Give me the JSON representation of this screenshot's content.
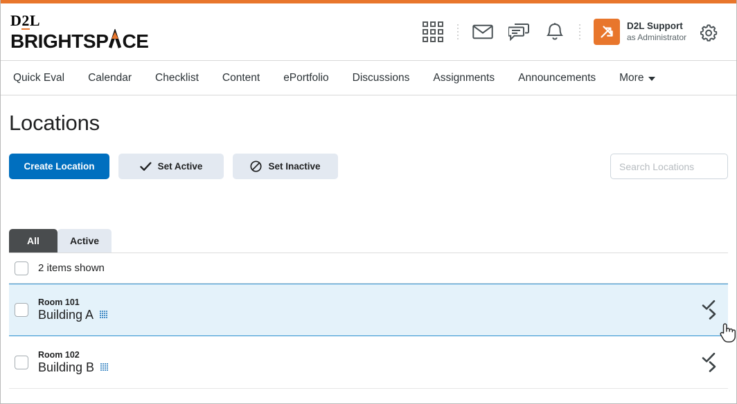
{
  "theme": {
    "accent_orange": "#e8762c",
    "primary_blue": "#006fbf",
    "selected_row_bg": "#e4f2fa",
    "selected_row_border": "#2a8fd0",
    "tab_active_bg": "#494c4e",
    "secondary_button_bg": "#e3e9f1"
  },
  "header": {
    "logo_d2l_prefix": "D",
    "logo_d2l_two": "2",
    "logo_d2l_suffix": "L",
    "logo_brightspace_part1": "BRIGHTSP",
    "logo_brightspace_part2": "CE",
    "icons": {
      "waffle": "waffle-grid-icon",
      "email": "envelope-icon",
      "messages": "chat-bubbles-icon",
      "notifications": "bell-icon",
      "settings": "gear-icon",
      "avatar": "swap-arrows-icon"
    },
    "user": {
      "name": "D2L Support",
      "role": "as Administrator"
    }
  },
  "nav": {
    "items": [
      {
        "label": "Quick Eval"
      },
      {
        "label": "Calendar"
      },
      {
        "label": "Checklist"
      },
      {
        "label": "Content"
      },
      {
        "label": "ePortfolio"
      },
      {
        "label": "Discussions"
      },
      {
        "label": "Assignments"
      },
      {
        "label": "Announcements"
      },
      {
        "label": "More"
      }
    ]
  },
  "page": {
    "title": "Locations"
  },
  "toolbar": {
    "create_label": "Create Location",
    "set_active_label": "Set Active",
    "set_inactive_label": "Set Inactive",
    "set_active_icon": "checkmark-icon",
    "set_inactive_icon": "prohibited-icon"
  },
  "search": {
    "placeholder": "Search Locations",
    "value": "",
    "icon": "search-icon"
  },
  "tabs": [
    {
      "label": "All",
      "state": "active"
    },
    {
      "label": "Active",
      "state": "inactive"
    }
  ],
  "list": {
    "header_label": "2 items shown",
    "rows": [
      {
        "code": "Room 101",
        "name": "Building A",
        "badge_icon": "grid-badge-icon",
        "action_check_icon": "checkmark-icon",
        "action_chevron_icon": "chevron-right-icon",
        "selected": true
      },
      {
        "code": "Room 102",
        "name": "Building B",
        "badge_icon": "grid-badge-icon",
        "action_check_icon": "checkmark-icon",
        "action_chevron_icon": "chevron-right-icon",
        "selected": false
      }
    ]
  },
  "cursor": {
    "icon": "pointing-hand-cursor"
  }
}
